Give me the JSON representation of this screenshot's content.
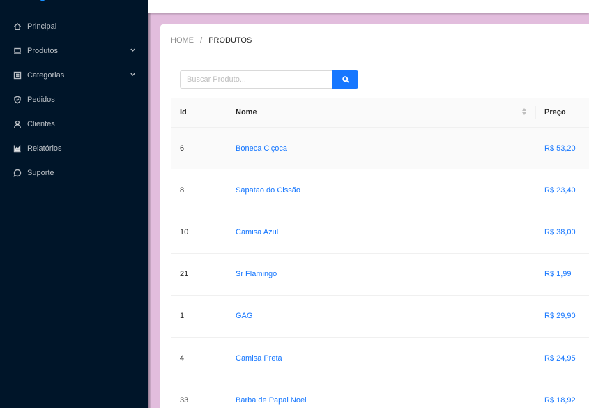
{
  "sidebar": {
    "items": [
      {
        "label": "Principal",
        "icon": "home-icon",
        "has_children": false
      },
      {
        "label": "Produtos",
        "icon": "laptop-icon",
        "has_children": true
      },
      {
        "label": "Categorias",
        "icon": "list-icon",
        "has_children": true
      },
      {
        "label": "Pedidos",
        "icon": "shield-check-icon",
        "has_children": false
      },
      {
        "label": "Clientes",
        "icon": "user-icon",
        "has_children": false
      },
      {
        "label": "Relatórios",
        "icon": "area-chart-icon",
        "has_children": false
      },
      {
        "label": "Suporte",
        "icon": "message-icon",
        "has_children": false
      }
    ]
  },
  "breadcrumb": {
    "home": "HOME",
    "separator": "/",
    "current": "PRODUTOS"
  },
  "search": {
    "placeholder": "Buscar Produto...",
    "value": ""
  },
  "table": {
    "columns": [
      "Id",
      "Nome",
      "Preço"
    ],
    "rows": [
      {
        "id": "6",
        "nome": "Boneca Ciçoca",
        "preco": "R$ 53,20"
      },
      {
        "id": "8",
        "nome": "Sapatao do Cissão",
        "preco": "R$ 23,40"
      },
      {
        "id": "10",
        "nome": "Camisa Azul",
        "preco": "R$ 38,00"
      },
      {
        "id": "21",
        "nome": "Sr Flamingo",
        "preco": "R$ 1,99"
      },
      {
        "id": "1",
        "nome": "GAG",
        "preco": "R$ 29,90"
      },
      {
        "id": "4",
        "nome": "Camisa Preta",
        "preco": "R$ 24,95"
      },
      {
        "id": "33",
        "nome": "Barba de Papai Noel",
        "preco": "R$ 18,92"
      }
    ]
  },
  "colors": {
    "sidebar_bg": "#001529",
    "page_bg": "#e2bddd",
    "accent": "#1677ff"
  }
}
